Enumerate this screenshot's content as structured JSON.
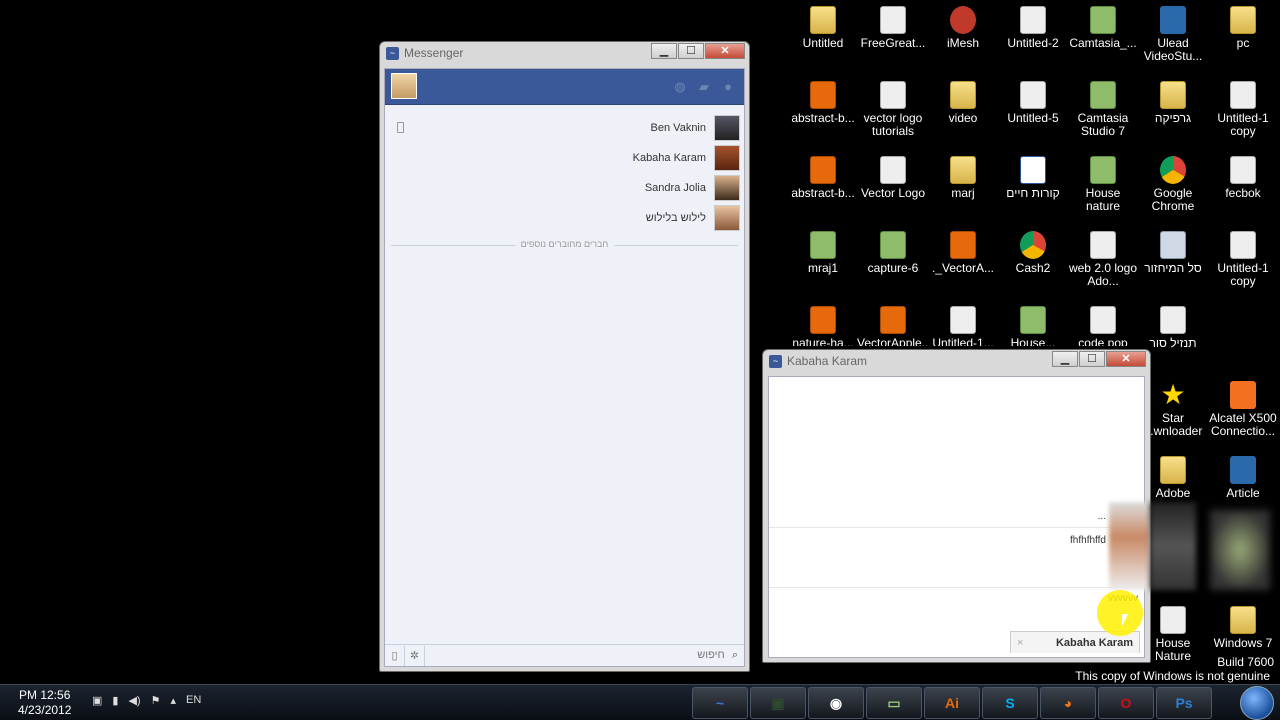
{
  "desktop_icons": [
    {
      "label": "Untitled",
      "icon": "folder-icon"
    },
    {
      "label": "FreeGreat...",
      "icon": "file-icon"
    },
    {
      "label": "iMesh",
      "icon": "imesh-icon"
    },
    {
      "label": "Untitled-2",
      "icon": "file-icon"
    },
    {
      "label": "Camtasia_...",
      "icon": "camtasia-icon"
    },
    {
      "label": "Ulead VideoStu...",
      "icon": "ulead-icon"
    },
    {
      "label": "pc",
      "icon": "folder-icon"
    },
    {
      "label": "abstract-b...",
      "icon": "ai-file-icon"
    },
    {
      "label": "vector logo tutorials",
      "icon": "file-icon"
    },
    {
      "label": "video",
      "icon": "folder-icon"
    },
    {
      "label": "Untitled-5",
      "icon": "file-icon"
    },
    {
      "label": "Camtasia Studio 7",
      "icon": "camtasia-icon"
    },
    {
      "label": "גרפיקה",
      "icon": "folder-icon"
    },
    {
      "label": "Untitled-1 copy",
      "icon": "file-icon"
    },
    {
      "label": "abstract-b...",
      "icon": "ai-file-icon"
    },
    {
      "label": "Vector Logo",
      "icon": "file-icon"
    },
    {
      "label": "marj",
      "icon": "folder-icon"
    },
    {
      "label": "קורות חיים",
      "icon": "word-icon"
    },
    {
      "label": "House nature",
      "icon": "image-icon"
    },
    {
      "label": "Google Chrome",
      "icon": "chrome-icon"
    },
    {
      "label": "fecbok",
      "icon": "file-icon"
    },
    {
      "label": "mraj1",
      "icon": "camtasia-icon"
    },
    {
      "label": "capture-6",
      "icon": "video-icon"
    },
    {
      "label": "._VectorA...",
      "icon": "ai-file-icon"
    },
    {
      "label": "Cash2",
      "icon": "chrome-icon"
    },
    {
      "label": "web 2.0 logo Ado...",
      "icon": "file-icon"
    },
    {
      "label": "סל המיחזור",
      "icon": "recycle-bin-icon"
    },
    {
      "label": "Untitled-1 copy",
      "icon": "file-icon"
    },
    {
      "label": "nature-ha...",
      "icon": "ai-file-icon"
    },
    {
      "label": "VectorApple...",
      "icon": "ai-file-icon"
    },
    {
      "label": "Untitled-1...",
      "icon": "file-icon"
    },
    {
      "label": "House...",
      "icon": "image-icon"
    },
    {
      "label": "code pop",
      "icon": "file-icon"
    },
    {
      "label": "תנזיל סור",
      "icon": "file-icon"
    },
    {
      "label": "Star ...wnloader",
      "icon": "star-icon"
    },
    {
      "label": "Alcatel X500 Connectio...",
      "icon": "alcatel-icon"
    },
    {
      "label": "Adobe",
      "icon": "folder-icon"
    },
    {
      "label": "Article",
      "icon": "people-icon"
    },
    {
      "label": "House Nature",
      "icon": "file-icon"
    },
    {
      "label": "Windows 7",
      "icon": "folder-icon"
    }
  ],
  "messenger": {
    "title": "Messenger",
    "contacts": [
      {
        "name": "Ben Vaknin",
        "mobile": true
      },
      {
        "name": "Kabaha Karam",
        "mobile": false
      },
      {
        "name": "Sandra Jolia",
        "mobile": false
      },
      {
        "name": "לילוש בלילוש",
        "mobile": false
      }
    ],
    "divider_label": "חברים מחוברים נוספים",
    "search_placeholder": "חיפוש"
  },
  "chat": {
    "title": "Kabaha Karam",
    "messages": [
      {
        "text": "..."
      },
      {
        "text": "fhfhfhffd"
      },
      {
        "text": "vvvvvv"
      }
    ],
    "tab_label": "Kabaha Karam",
    "tab_close": "×"
  },
  "taskbar": {
    "time": "PM 12:56",
    "date": "4/23/2012",
    "language": "EN",
    "apps": [
      {
        "name": "messenger-task-icon",
        "glyph": "~"
      },
      {
        "name": "camtasia-task-icon",
        "glyph": "▣"
      },
      {
        "name": "chrome-task-icon",
        "glyph": "◉"
      },
      {
        "name": "folder-task-icon",
        "glyph": "▭"
      },
      {
        "name": "illustrator-task-icon",
        "glyph": "Ai"
      },
      {
        "name": "skype-task-icon",
        "glyph": "S"
      },
      {
        "name": "firefox-task-icon",
        "glyph": "◕"
      },
      {
        "name": "opera-task-icon",
        "glyph": "O"
      },
      {
        "name": "photoshop-task-icon",
        "glyph": "Ps"
      }
    ]
  },
  "watermark": {
    "build": "Build 7600",
    "notice": "This copy of Windows is not genuine"
  }
}
